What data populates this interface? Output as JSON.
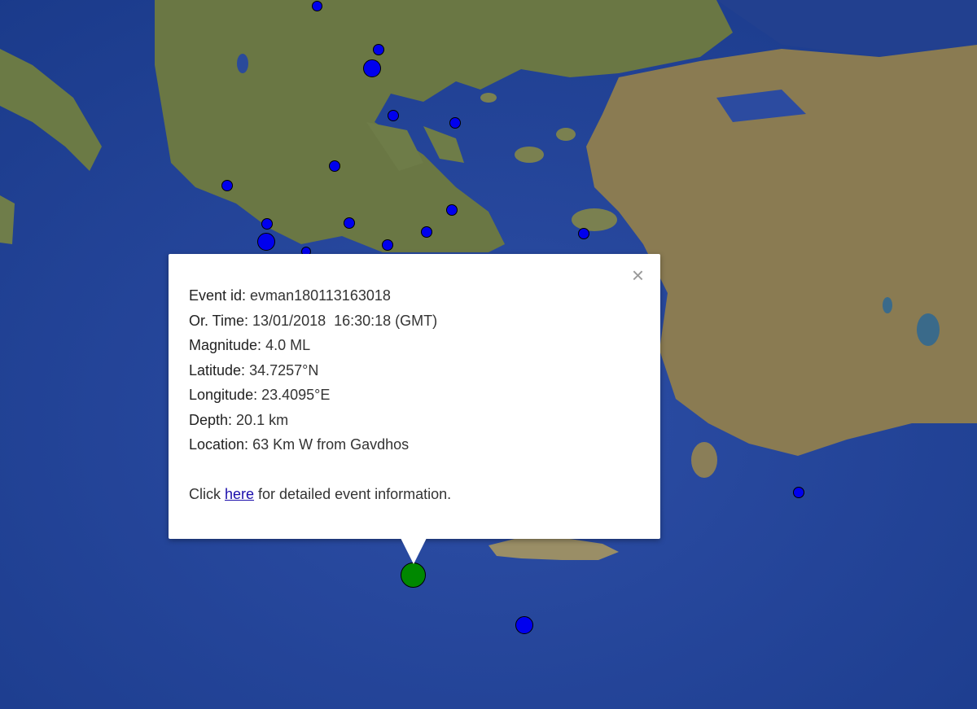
{
  "colors": {
    "blue": "#0000ee",
    "green": "#008800"
  },
  "popup": {
    "close_icon": "×",
    "fields": [
      {
        "key": "Event id:",
        "value": " evman180113163018"
      },
      {
        "key": "Or. Time:",
        "value": " 13/01/2018  16:30:18 (GMT)"
      },
      {
        "key": "Magnitude:",
        "value": " 4.0 ML"
      },
      {
        "key": "Latitude:",
        "value": " 34.7257°N"
      },
      {
        "key": "Longitude:",
        "value": " 23.4095°E"
      },
      {
        "key": "Depth:",
        "value": " 20.1 km"
      },
      {
        "key": "Location:",
        "value": " 63 Km W from Gavdhos"
      }
    ],
    "footer": {
      "prefix": "Click ",
      "link": "here",
      "suffix": " for detailed event information."
    }
  }
}
